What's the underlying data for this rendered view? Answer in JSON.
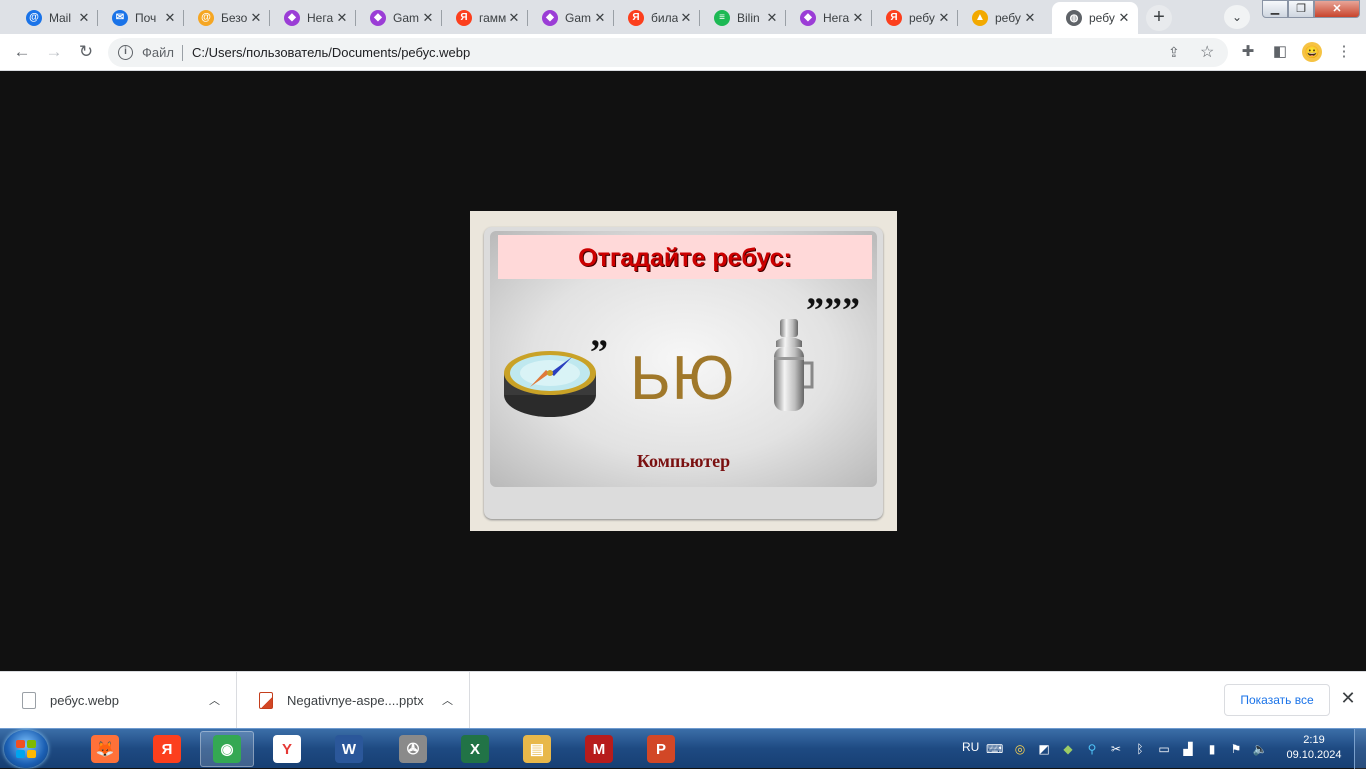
{
  "browser": {
    "tabs": [
      {
        "title": "Mail",
        "favicon": "mail-at-icon",
        "color": "#1a73e8",
        "glyph": "@"
      },
      {
        "title": "Поч",
        "favicon": "mail-envelope-icon",
        "color": "#1a73e8",
        "glyph": "✉"
      },
      {
        "title": "Безо",
        "favicon": "mail-at-icon",
        "color": "#f5a623",
        "glyph": "@"
      },
      {
        "title": "Нега",
        "favicon": "gamma-hexagon-icon",
        "color": "#9b3dd6",
        "glyph": "◆"
      },
      {
        "title": "Gam",
        "favicon": "gamma-hexagon-icon",
        "color": "#9b3dd6",
        "glyph": "◆"
      },
      {
        "title": "гамм",
        "favicon": "yandex-icon",
        "color": "#fc3f1d",
        "glyph": "Я"
      },
      {
        "title": "Gam",
        "favicon": "gamma-hexagon-icon",
        "color": "#9b3dd6",
        "glyph": "◆"
      },
      {
        "title": "била",
        "favicon": "yandex-icon",
        "color": "#fc3f1d",
        "glyph": "Я"
      },
      {
        "title": "Bilin",
        "favicon": "spotify-icon",
        "color": "#1db954",
        "glyph": "≡"
      },
      {
        "title": "Нега",
        "favicon": "gamma-hexagon-icon",
        "color": "#9b3dd6",
        "glyph": "◆"
      },
      {
        "title": "ребу",
        "favicon": "yandex-icon",
        "color": "#fc3f1d",
        "glyph": "Я"
      },
      {
        "title": "ребу",
        "favicon": "image-icon",
        "color": "#f2a900",
        "glyph": "▲"
      },
      {
        "title": "ребу",
        "favicon": "globe-icon",
        "color": "#5f6368",
        "glyph": "◍",
        "active": true
      }
    ],
    "new_tab_label": "+",
    "address": {
      "scheme_label": "Файл",
      "url": "C:/Users/пользователь/Documents/ребус.webp"
    }
  },
  "content": {
    "image": {
      "heading": "Отгадайте ребус:",
      "word": "ЬЮ",
      "comma_left": "”",
      "comma_right": "”””",
      "answer": "Компьютер"
    }
  },
  "downloads": {
    "items": [
      {
        "name": "ребус.webp",
        "type": "image"
      },
      {
        "name": "Negativnye-aspe....pptx",
        "type": "pptx"
      }
    ],
    "show_all_label": "Показать все"
  },
  "taskbar": {
    "apps": [
      {
        "name": "firefox-icon",
        "glyph": "🦊",
        "color": "#ff7139"
      },
      {
        "name": "yandex-icon",
        "glyph": "Я",
        "color": "#fc3f1d"
      },
      {
        "name": "chrome-icon",
        "glyph": "◉",
        "color": "#34a853",
        "active": true
      },
      {
        "name": "yandex-browser-icon",
        "glyph": "Y",
        "color": "#ffffff"
      },
      {
        "name": "word-icon",
        "glyph": "W",
        "color": "#2b579a"
      },
      {
        "name": "media-player-icon",
        "glyph": "✇",
        "color": "#8a8a8a"
      },
      {
        "name": "excel-icon",
        "glyph": "X",
        "color": "#217346"
      },
      {
        "name": "explorer-icon",
        "glyph": "▤",
        "color": "#e8b84a"
      },
      {
        "name": "pdf-master-icon",
        "glyph": "M",
        "color": "#b71c1c"
      },
      {
        "name": "powerpoint-icon",
        "glyph": "P",
        "color": "#d24726"
      }
    ],
    "tray": {
      "lang": "RU",
      "time": "2:19",
      "date": "09.10.2024"
    }
  }
}
